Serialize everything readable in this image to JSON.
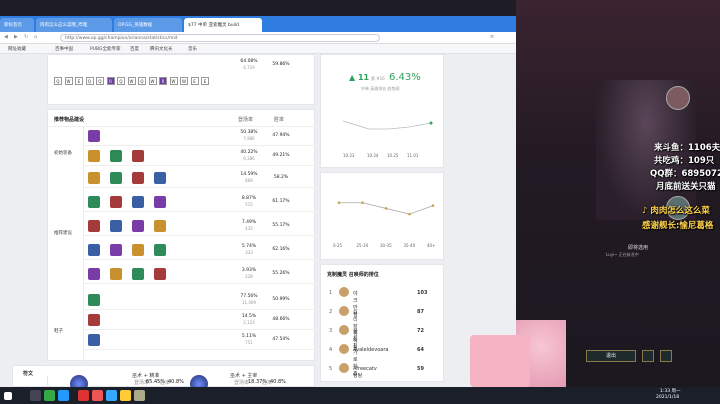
{
  "browser": {
    "tabs": [
      {
        "label": "新标签页"
      },
      {
        "label": "肉肉怎么这么菜哦_哔哩"
      },
      {
        "label": "OP.GG_英雄数据"
      },
      {
        "label": "$77 中单 亚索魔灵 build"
      }
    ],
    "url": "http://www.op.gg/champion/orianna/statistics/mid",
    "bookmarks": [
      "网址收藏",
      "百事中国",
      "PUBG全能专家",
      "百度",
      "腾讯文化长",
      "音乐"
    ]
  },
  "skill_order": {
    "pick": "64.08%",
    "count": "4,719",
    "winrate": "59.86%",
    "keys": [
      "Q",
      "W",
      "E",
      "Q",
      "Q",
      "R",
      "Q",
      "W",
      "Q",
      "W",
      "R",
      "W",
      "W",
      "E",
      "E"
    ]
  },
  "items_section": {
    "title": "推荐物品建设",
    "col_pick": "登场率",
    "col_win": "胜率",
    "categories": [
      {
        "name": "初始装备",
        "rows": [
          {
            "pick": "50.38%",
            "count": "7,986",
            "win": "47.94%"
          },
          {
            "pick": "40.22%",
            "count": "6,386",
            "win": "49.21%"
          }
        ]
      },
      {
        "name": "推荐建设",
        "rows": [
          {
            "pick": "14.59%",
            "count": "868",
            "win": "58.2%"
          },
          {
            "pick": "8.87%",
            "count": "515",
            "win": "61.17%"
          },
          {
            "pick": "7.49%",
            "count": "435",
            "win": "55.17%"
          },
          {
            "pick": "5.74%",
            "count": "333",
            "win": "62.16%"
          },
          {
            "pick": "3.93%",
            "count": "228",
            "win": "55.26%"
          }
        ]
      },
      {
        "name": "鞋子",
        "rows": [
          {
            "pick": "77.56%",
            "count": "11,409",
            "win": "50.99%"
          },
          {
            "pick": "14.5%",
            "count": "2,133",
            "win": "48.66%"
          },
          {
            "pick": "5.11%",
            "count": "751",
            "win": "47.54%"
          }
        ]
      }
    ]
  },
  "runes": {
    "title": "符文",
    "pick": "65.45%",
    "win": "40.8%",
    "pick2": "18.37%",
    "win2": "40.8%",
    "name1": "巫术 + 精准",
    "name2": "巫术 + 主宰",
    "label_pick": "登场率",
    "label_win": "胜率"
  },
  "trend": {
    "rank": "11",
    "rank_note": "第 #16",
    "winrate": "6.43%",
    "label": "中单 英雄排名 趋势图",
    "x": [
      "10.23",
      "10.24",
      "10.25",
      "11.01"
    ]
  },
  "chart_data": {
    "type": "line",
    "categories": [
      "0-25",
      "25-30",
      "30-35",
      "35-40",
      "40+"
    ],
    "values": [
      52,
      52,
      50,
      48,
      51
    ],
    "ylim": [
      40,
      54
    ]
  },
  "counters": {
    "title": "克制魔灵 召唤师的排位",
    "rows": [
      {
        "rank": "1",
        "name": "야크 만 질",
        "games": "103"
      },
      {
        "rank": "2",
        "name": "요리 잘생 해정",
        "games": "87"
      },
      {
        "rank": "3",
        "name": "불친진 가로하죠",
        "games": "72"
      },
      {
        "rank": "4",
        "name": "Avaleldevoara",
        "games": "64"
      },
      {
        "rank": "5",
        "name": "Afreecatv 텅텅",
        "games": "59"
      }
    ]
  },
  "stream": {
    "lines": [
      "来斗鱼：1106夫",
      "共吃鸡：109只",
      "QQ群：689507299",
      "月底前送关只猫"
    ],
    "sub1": "肉肉怎么这么菜",
    "sub2": "感谢舰长:愉尼葛格",
    "lock_label": "即将选用",
    "exit": "退出",
    "player": "Luyi~ 正在斩龙中"
  },
  "taskbar": {
    "time": "1:33 周一",
    "date": "2021/1/18"
  }
}
